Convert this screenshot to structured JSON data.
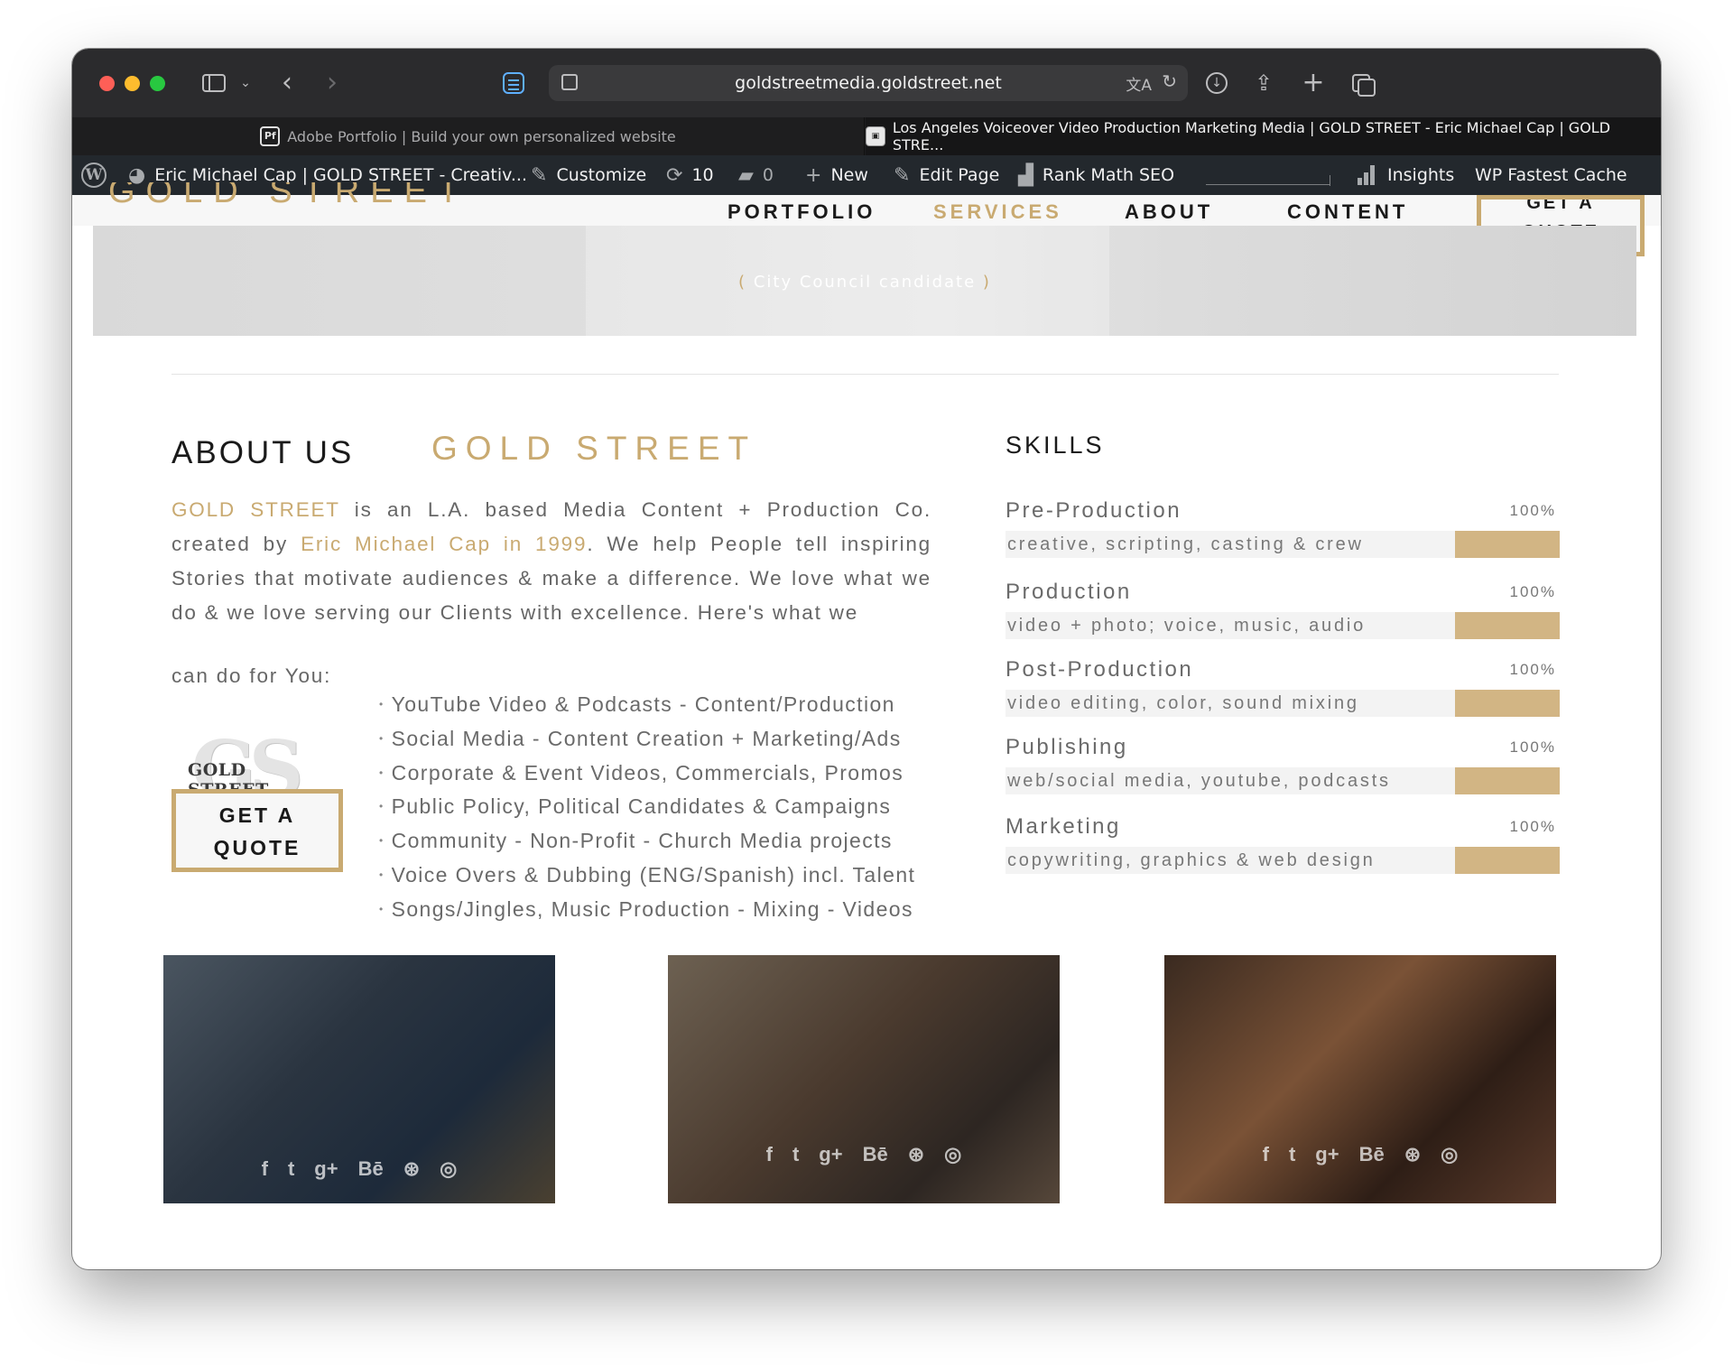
{
  "browser": {
    "url": "goldstreetmedia.goldstreet.net",
    "tabs": [
      {
        "label": "Adobe Portfolio | Build your own personalized website"
      },
      {
        "label": "Los Angeles Voiceover Video Production Marketing Media | GOLD STREET - Eric Michael Cap | GOLD STRE..."
      }
    ]
  },
  "adminbar": {
    "site_name": "Eric Michael Cap | GOLD STREET - Creativ...",
    "customize": "Customize",
    "updates": "10",
    "comments": "0",
    "new": "New",
    "edit_page": "Edit Page",
    "rank_math": "Rank Math SEO",
    "insights": "Insights",
    "wp_fastest_cache": "WP Fastest Cache"
  },
  "header": {
    "logo": "GOLD STREET",
    "nav": [
      "PORTFOLIO",
      "SERVICES",
      "ABOUT",
      "CONTENT"
    ],
    "quote_line1": "GET A",
    "quote_line2": "QUOTE"
  },
  "hero": {
    "caption_open": "(",
    "caption": "City Council candidate",
    "caption_close": ")"
  },
  "about": {
    "title": "ABOUT US",
    "brand_title": "GOLD STREET",
    "brand": "GOLD STREET",
    "intro_1": " is an L.A. based Media Content + Production Co. created by ",
    "creator": "Eric Michael Cap in 1999",
    "intro_2": ".  We help People tell inspiring Stories that motivate audiences & make a difference. We love what we do & we love serving our Clients with excellence. Here's what we",
    "intro_last": "can do for You:",
    "services": [
      "YouTube Video & Podcasts - Content/Production",
      "Social Media - Content Creation + Marketing/Ads",
      "Corporate & Event Videos, Commercials, Promos",
      "Public Policy, Political Candidates & Campaigns",
      "Community - Non-Profit - Church Media projects",
      "Voice Overs & Dubbing (ENG/Spanish) incl. Talent",
      "Songs/Jingles, Music Production - Mixing - Videos"
    ],
    "logo_text": "GOLD STREET",
    "logo_mark": "GS",
    "quote_line1": "GET A",
    "quote_line2": "QUOTE"
  },
  "skills": {
    "title": "SKILLS",
    "items": [
      {
        "name": "Pre-Production",
        "percent": "100%",
        "level": 100,
        "desc": "creative, scripting, casting & crew"
      },
      {
        "name": "Production",
        "percent": "100%",
        "level": 100,
        "desc": "video + photo; voice, music, audio"
      },
      {
        "name": "Post-Production",
        "percent": "100%",
        "level": 100,
        "desc": "video editing, color, sound mixing"
      },
      {
        "name": "Publishing",
        "percent": "100%",
        "level": 100,
        "desc": "web/social media, youtube, podcasts"
      },
      {
        "name": "Marketing",
        "percent": "100%",
        "level": 100,
        "desc": "copywriting, graphics & web design"
      }
    ]
  },
  "team": {
    "social_icons": [
      "f",
      "t",
      "g+",
      "Bē",
      "⊛",
      "◎"
    ]
  },
  "colors": {
    "gold": "#c9aa71",
    "bar_fill": "#d2b584",
    "admin_bar": "#23282d"
  }
}
